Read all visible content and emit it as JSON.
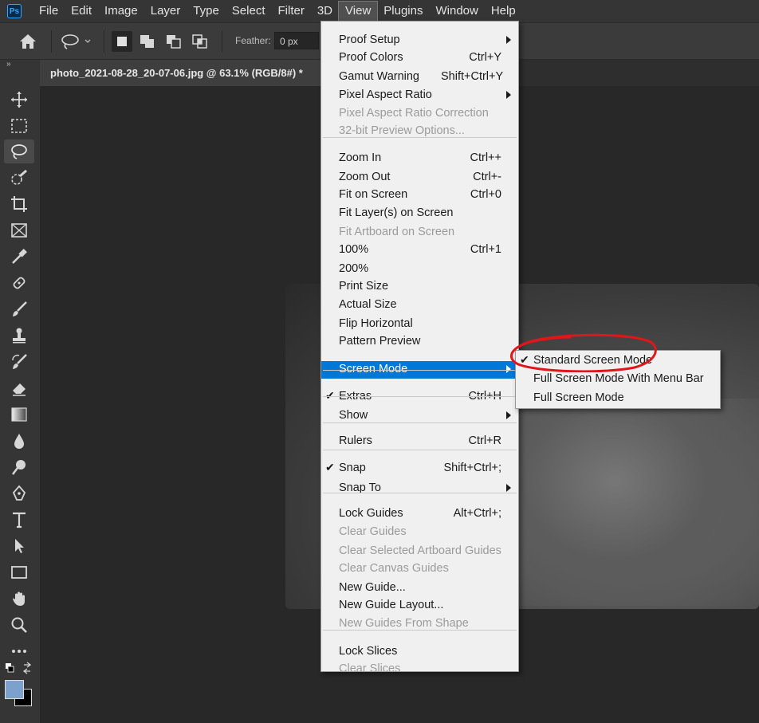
{
  "menubar": {
    "logo": "Ps",
    "items": [
      "File",
      "Edit",
      "Image",
      "Layer",
      "Type",
      "Select",
      "Filter",
      "3D",
      "View",
      "Plugins",
      "Window",
      "Help"
    ],
    "active": "View"
  },
  "options": {
    "feather_label": "Feather:",
    "feather_value": "0 px"
  },
  "toolbar": {
    "collapse": "»",
    "tools": [
      "move",
      "marquee",
      "lasso",
      "quick-selection",
      "crop",
      "frame",
      "eyedropper",
      "healing",
      "brush",
      "stamp",
      "history-brush",
      "eraser",
      "gradient",
      "blur",
      "dodge",
      "pen",
      "type",
      "path-selection",
      "rectangle",
      "hand",
      "zoom",
      "more"
    ],
    "selected": "lasso",
    "foreground_color": "#7ba1cc",
    "background_color": "#000000"
  },
  "document": {
    "tab_title": "photo_2021-08-28_20-07-06.jpg @ 63.1% (RGB/8#) *"
  },
  "view_menu": {
    "items": [
      {
        "label": "Proof Setup",
        "shortcut": "",
        "submenu": true,
        "disabled": false
      },
      {
        "label": "Proof Colors",
        "shortcut": "Ctrl+Y",
        "submenu": false,
        "disabled": false
      },
      {
        "label": "Gamut Warning",
        "shortcut": "Shift+Ctrl+Y",
        "submenu": false,
        "disabled": false
      },
      {
        "label": "Pixel Aspect Ratio",
        "shortcut": "",
        "submenu": true,
        "disabled": false
      },
      {
        "label": "Pixel Aspect Ratio Correction",
        "shortcut": "",
        "submenu": false,
        "disabled": true
      },
      {
        "label": "32-bit Preview Options...",
        "shortcut": "",
        "submenu": false,
        "disabled": true
      },
      {
        "label": "Zoom In",
        "shortcut": "Ctrl++",
        "submenu": false,
        "disabled": false
      },
      {
        "label": "Zoom Out",
        "shortcut": "Ctrl+-",
        "submenu": false,
        "disabled": false
      },
      {
        "label": "Fit on Screen",
        "shortcut": "Ctrl+0",
        "submenu": false,
        "disabled": false
      },
      {
        "label": "Fit Layer(s) on Screen",
        "shortcut": "",
        "submenu": false,
        "disabled": false
      },
      {
        "label": "Fit Artboard on Screen",
        "shortcut": "",
        "submenu": false,
        "disabled": true
      },
      {
        "label": "100%",
        "shortcut": "Ctrl+1",
        "submenu": false,
        "disabled": false
      },
      {
        "label": "200%",
        "shortcut": "",
        "submenu": false,
        "disabled": false
      },
      {
        "label": "Print Size",
        "shortcut": "",
        "submenu": false,
        "disabled": false
      },
      {
        "label": "Actual Size",
        "shortcut": "",
        "submenu": false,
        "disabled": false
      },
      {
        "label": "Flip Horizontal",
        "shortcut": "",
        "submenu": false,
        "disabled": false
      },
      {
        "label": "Pattern Preview",
        "shortcut": "",
        "submenu": false,
        "disabled": false
      },
      {
        "label": "Screen Mode",
        "shortcut": "",
        "submenu": true,
        "disabled": false,
        "highlighted": true
      },
      {
        "label": "Extras",
        "shortcut": "Ctrl+H",
        "submenu": false,
        "disabled": false,
        "checked": true
      },
      {
        "label": "Show",
        "shortcut": "",
        "submenu": true,
        "disabled": false
      },
      {
        "label": "Rulers",
        "shortcut": "Ctrl+R",
        "submenu": false,
        "disabled": false
      },
      {
        "label": "Snap",
        "shortcut": "Shift+Ctrl+;",
        "submenu": false,
        "disabled": false,
        "checked": true
      },
      {
        "label": "Snap To",
        "shortcut": "",
        "submenu": true,
        "disabled": false
      },
      {
        "label": "Lock Guides",
        "shortcut": "Alt+Ctrl+;",
        "submenu": false,
        "disabled": false
      },
      {
        "label": "Clear Guides",
        "shortcut": "",
        "submenu": false,
        "disabled": true
      },
      {
        "label": "Clear Selected Artboard Guides",
        "shortcut": "",
        "submenu": false,
        "disabled": true
      },
      {
        "label": "Clear Canvas Guides",
        "shortcut": "",
        "submenu": false,
        "disabled": true
      },
      {
        "label": "New Guide...",
        "shortcut": "",
        "submenu": false,
        "disabled": false
      },
      {
        "label": "New Guide Layout...",
        "shortcut": "",
        "submenu": false,
        "disabled": false
      },
      {
        "label": "New Guides From Shape",
        "shortcut": "",
        "submenu": false,
        "disabled": true
      },
      {
        "label": "Lock Slices",
        "shortcut": "",
        "submenu": false,
        "disabled": false
      },
      {
        "label": "Clear Slices",
        "shortcut": "",
        "submenu": false,
        "disabled": true
      }
    ]
  },
  "screen_mode_submenu": {
    "items": [
      {
        "label": "Standard Screen Mode",
        "checked": true
      },
      {
        "label": "Full Screen Mode With Menu Bar",
        "checked": false
      },
      {
        "label": "Full Screen Mode",
        "checked": false
      }
    ]
  },
  "colors": {
    "highlight": "#0078d7",
    "annotation_circle": "#e0161b"
  }
}
